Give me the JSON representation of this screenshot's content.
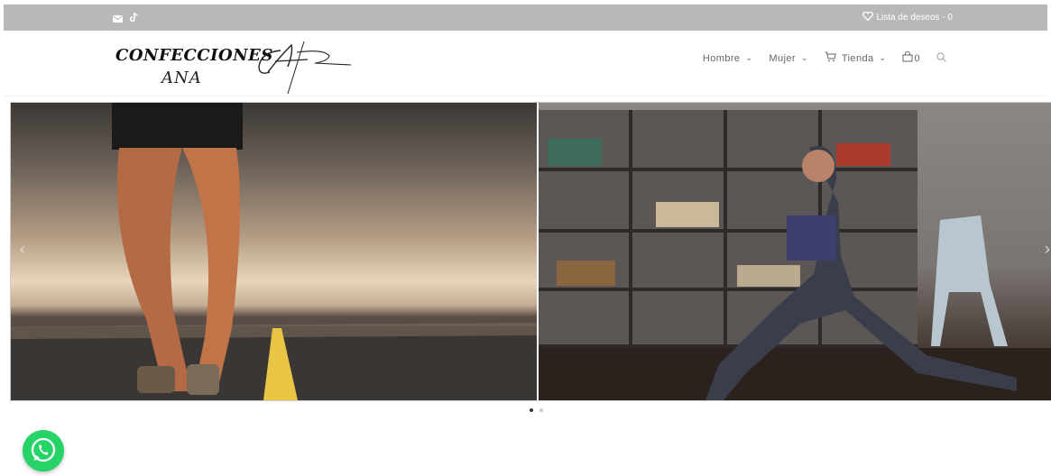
{
  "topbar": {
    "social_icons": [
      "envelope-icon",
      "tiktok-icon"
    ],
    "wishlist_label": "Lista de deseos - 0"
  },
  "logo": {
    "line1": "CONFECCIONES",
    "line2": "ANA"
  },
  "nav": {
    "items": [
      {
        "label": "Hombre"
      },
      {
        "label": "Mujer"
      },
      {
        "label": "Tienda"
      }
    ],
    "cart_count": "0"
  },
  "slider": {
    "slides": [
      "runner-on-road",
      "woman-stretching-bookshelf"
    ],
    "active_index": 0,
    "total": 2
  },
  "colors": {
    "topbar_bg": "#b8b8b8",
    "whatsapp": "#25d366"
  }
}
